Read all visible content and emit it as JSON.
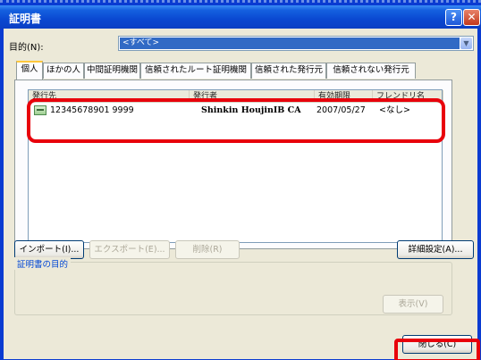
{
  "window": {
    "title": "証明書"
  },
  "purpose": {
    "label": "目的(N):",
    "value": "<すべて>"
  },
  "tabs": [
    {
      "label": "個人"
    },
    {
      "label": "ほかの人"
    },
    {
      "label": "中間証明機関"
    },
    {
      "label": "信頼されたルート証明機関"
    },
    {
      "label": "信頼された発行元"
    },
    {
      "label": "信頼されない発行元"
    }
  ],
  "list": {
    "columns": [
      {
        "label": "発行先"
      },
      {
        "label": "発行者"
      },
      {
        "label": "有効期限"
      },
      {
        "label": "フレンドリ名"
      }
    ],
    "rows": [
      {
        "issued_to": "12345678901 9999",
        "issued_by": "Shinkin HoujinIB CA",
        "expiry": "2007/05/27",
        "friendly_name": "<なし>"
      }
    ]
  },
  "buttons": {
    "import": "インポート(I)...",
    "export": "エクスポート(E)...",
    "remove": "削除(R)",
    "advanced": "詳細設定(A)...",
    "view": "表示(V)",
    "close": "閉じる(C)"
  },
  "group": {
    "label": "証明書の目的"
  },
  "titlebar_buttons": {
    "help": "?",
    "close": "✕"
  },
  "colors": {
    "highlight": "#e8000b",
    "selection": "#316ac5",
    "titlebar": "#0a48d1"
  }
}
